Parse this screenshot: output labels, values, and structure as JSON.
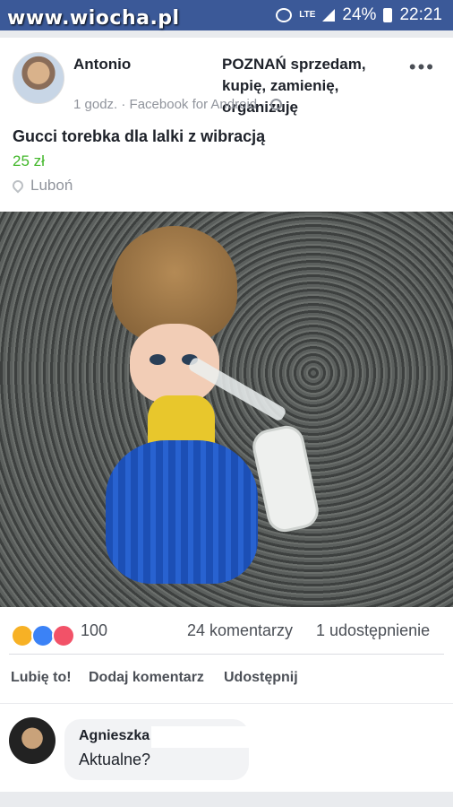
{
  "watermark": "www.wiocha.pl",
  "status": {
    "lte": "LTE",
    "battery": "24%",
    "time": "22:21"
  },
  "post": {
    "author": "Antonio",
    "group": "POZNAŃ sprzedam, kupię, zamienię, organizuję",
    "meta": "1 godz. · Facebook for Android ·",
    "menu": "•••"
  },
  "listing": {
    "title": "Gucci torebka dla lalki z wibracją",
    "price": "25 zł",
    "location": "Luboń"
  },
  "reactions": {
    "count": "100",
    "comments": "24 komentarzy",
    "shares": "1 udostępnienie",
    "colors": {
      "haha": "#f7b125",
      "like": "#3b82f6",
      "love": "#f25268"
    }
  },
  "actions": {
    "like": "Lubię to!",
    "comment": "Dodaj komentarz",
    "share": "Udostępnij"
  },
  "comment": {
    "author": "Agnieszka",
    "text": "Aktualne?"
  }
}
